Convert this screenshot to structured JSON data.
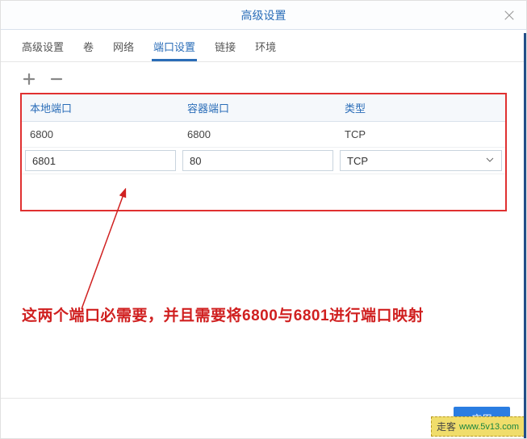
{
  "dialog": {
    "title": "高级设置"
  },
  "tabs": {
    "items": [
      {
        "label": "高级设置"
      },
      {
        "label": "卷"
      },
      {
        "label": "网络"
      },
      {
        "label": "端口设置"
      },
      {
        "label": "链接"
      },
      {
        "label": "环境"
      }
    ],
    "activeIndex": 3
  },
  "table": {
    "headers": {
      "local": "本地端口",
      "container": "容器端口",
      "type": "类型"
    },
    "rows": [
      {
        "local": "6800",
        "container": "6800",
        "type": "TCP",
        "editing": false
      },
      {
        "local": "6801",
        "container": "80",
        "type": "TCP",
        "editing": true
      }
    ]
  },
  "callout": "这两个端口必需要，并且需要将6800与6801进行端口映射",
  "footer": {
    "apply": "应用"
  },
  "watermark": {
    "text": "走客",
    "url": "www.5v13.com"
  }
}
